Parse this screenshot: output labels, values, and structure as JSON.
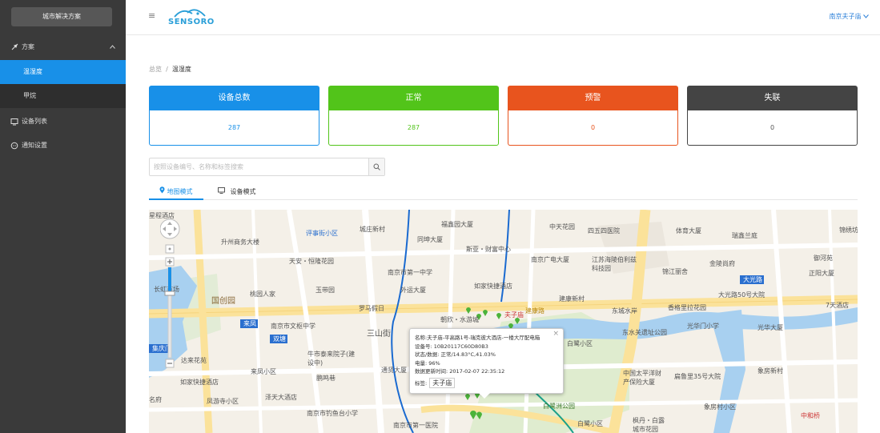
{
  "sidebar": {
    "title": "城市解决方案",
    "menu": {
      "label": "方案",
      "icon": "rocket-icon",
      "expanded_icon": "chevron-up-icon"
    },
    "sub_items": [
      {
        "label": "温湿度",
        "active": true
      },
      {
        "label": "甲烷",
        "active": false
      }
    ],
    "device_list": {
      "label": "设备列表",
      "icon": "monitor-icon"
    },
    "notify": {
      "label": "通知设置",
      "icon": "chat-icon"
    }
  },
  "header": {
    "logo_text": "SENSORO",
    "user": "南京夫子庙",
    "user_icon": "chevron-down-icon"
  },
  "breadcrumb": {
    "root": "总览",
    "sep": "/",
    "current": "温湿度"
  },
  "cards": [
    {
      "title": "设备总数",
      "value": "287",
      "color": "#1890e8"
    },
    {
      "title": "正常",
      "value": "287",
      "color": "#52c41a"
    },
    {
      "title": "预警",
      "value": "0",
      "color": "#e8541e"
    },
    {
      "title": "失联",
      "value": "0",
      "color": "#444444"
    }
  ],
  "search": {
    "placeholder": "按照设备编号、名称和标签搜索",
    "value": ""
  },
  "tabs": [
    {
      "label": "地图模式",
      "active": true,
      "icon": "map-pin-icon"
    },
    {
      "label": "设备模式",
      "active": false,
      "icon": "monitor-icon"
    }
  ],
  "map": {
    "labels": [
      {
        "t": "星程酒店"
      },
      {
        "t": "升州商务大楼"
      },
      {
        "t": "评事街小区"
      },
      {
        "t": "城庄新村"
      },
      {
        "t": "同坤大厦"
      },
      {
        "t": "福鑫园大厦"
      },
      {
        "t": "中天花园"
      },
      {
        "t": "四五四医院"
      },
      {
        "t": "体育大厦"
      },
      {
        "t": "瑞鑫兰庭"
      },
      {
        "t": "锦绣坊"
      },
      {
        "t": "天安・恒隆花园"
      },
      {
        "t": "南京市第一中学"
      },
      {
        "t": "斯亚・财富中心"
      },
      {
        "t": "南京广电大厦"
      },
      {
        "t": "江苏海陵伯利兹科技园"
      },
      {
        "t": "金陵尚府"
      },
      {
        "t": "御河苑"
      },
      {
        "t": "正阳大厦"
      },
      {
        "t": "大光路"
      },
      {
        "t": "长虹市场"
      },
      {
        "t": "桃园人家"
      },
      {
        "t": "玉带园"
      },
      {
        "t": "外运大厦"
      },
      {
        "t": "如家快捷酒店"
      },
      {
        "t": "锦江丽舍"
      },
      {
        "t": "大光路50号大院"
      },
      {
        "t": "国创园"
      },
      {
        "t": "罗马假日"
      },
      {
        "t": "朝欣・水游城"
      },
      {
        "t": "夫子庙"
      },
      {
        "t": "建康新村"
      },
      {
        "t": "东城水岸"
      },
      {
        "t": "香格里拉花园"
      },
      {
        "t": "7天酒店"
      },
      {
        "t": "来凤"
      },
      {
        "t": "南京市文枢中学"
      },
      {
        "t": "三山街"
      },
      {
        "t": "白鹭小区"
      },
      {
        "t": "东水关遗址公园"
      },
      {
        "t": "光华门小学"
      },
      {
        "t": "光华大厦"
      },
      {
        "t": "双塘"
      },
      {
        "t": "集庆门"
      },
      {
        "t": "牛市泰来院子(建设中)"
      },
      {
        "t": "达来花苑"
      },
      {
        "t": "来凤小区"
      },
      {
        "t": "鹏鸣巷"
      },
      {
        "t": "通贤大厦"
      },
      {
        "t": "中国太平洋财产保险大厦"
      },
      {
        "t": "扁鲁里35号大院"
      },
      {
        "t": "象房新村"
      },
      {
        "t": "如家快捷酒店"
      },
      {
        "t": "凤游寺小区"
      },
      {
        "t": "泽天大酒店"
      },
      {
        "t": "白鹭洲公园"
      },
      {
        "t": "南京市钓鱼台小学"
      },
      {
        "t": "南京市第一医院"
      },
      {
        "t": "枫丹・白露城市花园"
      },
      {
        "t": "中和桥"
      },
      {
        "t": "名府"
      },
      {
        "t": "建康路"
      },
      {
        "t": "象房村小区"
      },
      {
        "t": "白鹭小区"
      }
    ],
    "popup": {
      "name_label": "名称:",
      "name": "夫子庙-平高路1号-瑞克彼大酒店-一楼大厅配电箱",
      "sn_label": "设备号:",
      "sn": "10B20117C60D80B3",
      "status_label": "状态/数据:",
      "status": "正常/14.83°C,41.03%",
      "battery_label": "电量:",
      "battery": "96%",
      "update_label": "数据更新时间:",
      "update": "2017-02-07 22:35:12",
      "tag_label": "标签:",
      "tag": "夫子庙",
      "close": "×"
    }
  }
}
